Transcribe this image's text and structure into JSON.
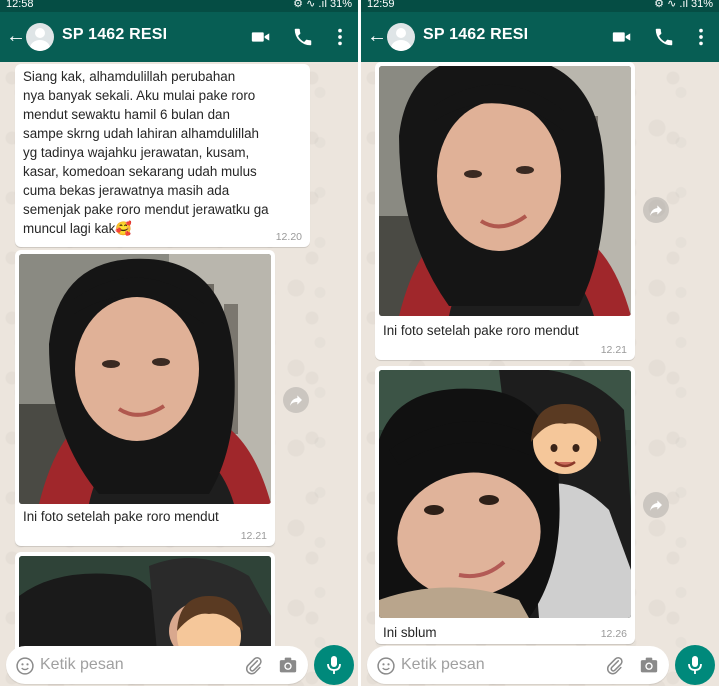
{
  "panes": [
    {
      "statusbar": {
        "time": "12:58",
        "indicators": "⚙ ∿ .ıl 31%"
      },
      "contact": {
        "name": "SP 1462 RESI"
      },
      "messages": {
        "text": "Siang kak, alhamdulillah perubahan nya banyak sekali. Aku mulai pake roro mendut sewaktu hamil 6 bulan dan sampe skrng udah lahiran alhamdulillah yg tadinya wajahku jerawatan, kusam, kasar, komedoan sekarang udah mulus cuma bekas jerawatnya masih ada semenjak pake roro mendut jerawatku ga muncul lagi kak🥰",
        "text_lines": [
          "Siang kak, alhamdulillah perubahan",
          "nya banyak sekali. Aku mulai pake roro",
          "mendut sewaktu hamil 6 bulan dan",
          "sampe skrng udah lahiran alhamdulillah",
          "yg tadinya wajahku jerawatan, kusam,",
          "kasar, komedoan sekarang udah mulus",
          "cuma bekas jerawatnya masih ada",
          "semenjak pake roro mendut jerawatku ga",
          "muncul lagi kak🥰"
        ],
        "text_time": "12.20",
        "photo1_caption": "Ini foto setelah pake roro mendut",
        "photo1_time": "12.21"
      },
      "input": {
        "placeholder": "Ketik pesan"
      }
    },
    {
      "statusbar": {
        "time": "12:59",
        "indicators": "⚙ ∿ .ıl 31%"
      },
      "contact": {
        "name": "SP 1462 RESI"
      },
      "messages": {
        "photo1_caption": "Ini foto setelah pake roro mendut",
        "photo1_time": "12.21",
        "photo2_caption": "Ini sblum",
        "photo2_time": "12.26"
      },
      "input": {
        "placeholder": "Ketik pesan"
      }
    }
  ],
  "icons": {
    "back": "arrow-left-icon",
    "video": "video-call-icon",
    "phone": "phone-icon",
    "menu": "more-vertical-icon",
    "forward": "forward-icon",
    "emoji": "emoji-icon",
    "attach": "paperclip-icon",
    "camera": "camera-icon",
    "mic": "microphone-icon"
  },
  "colors": {
    "header": "#075e54",
    "statusbar": "#054d44",
    "chat_bg": "#ece5dd",
    "bubble": "#ffffff",
    "mic_button": "#00897b"
  }
}
